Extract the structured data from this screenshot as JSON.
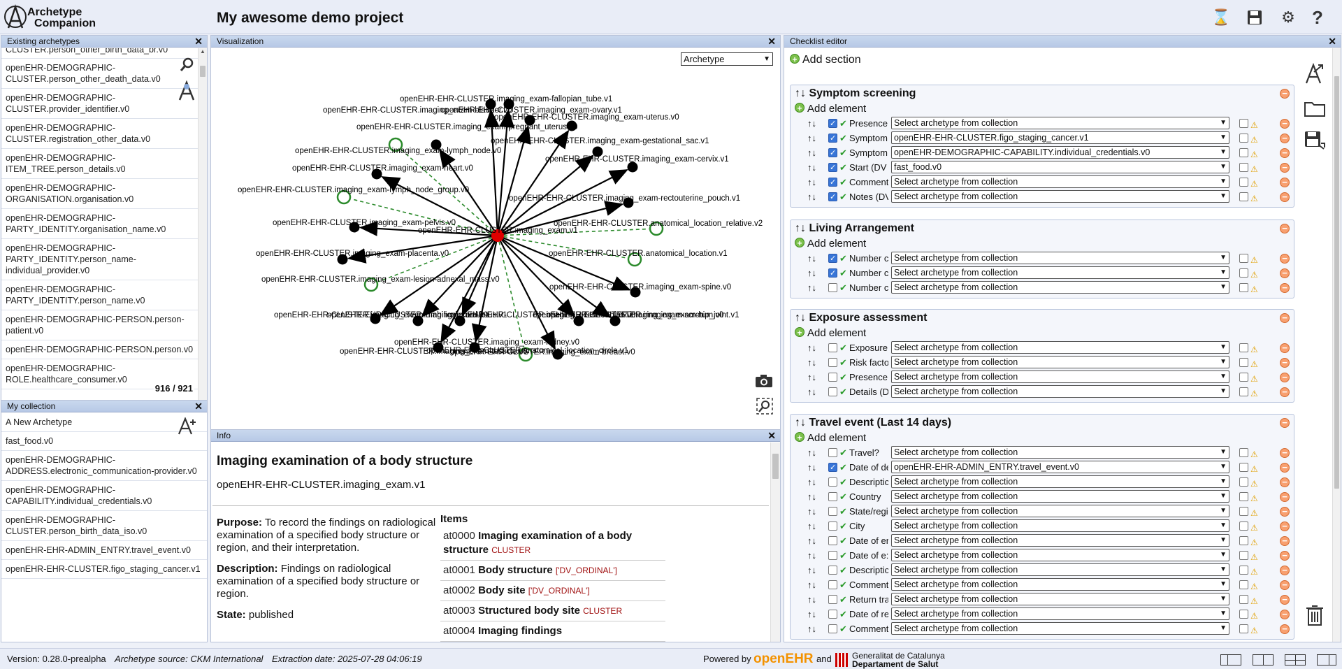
{
  "app": {
    "logo_line1": "Archetype",
    "logo_line2": "Companion",
    "project_title": "My awesome demo project"
  },
  "top_icons": [
    "hourglass-icon",
    "save-icon",
    "gear-icon",
    "help-icon"
  ],
  "existing_archetypes": {
    "title": "Existing archetypes",
    "items": [
      "CLUSTER.person_other_birth_data_br.v0",
      "openEHR-DEMOGRAPHIC-CLUSTER.person_other_death_data.v0",
      "openEHR-DEMOGRAPHIC-CLUSTER.provider_identifier.v0",
      "openEHR-DEMOGRAPHIC-CLUSTER.registration_other_data.v0",
      "openEHR-DEMOGRAPHIC-ITEM_TREE.person_details.v0",
      "openEHR-DEMOGRAPHIC-ORGANISATION.organisation.v0",
      "openEHR-DEMOGRAPHIC-PARTY_IDENTITY.organisation_name.v0",
      "openEHR-DEMOGRAPHIC-PARTY_IDENTITY.person_name-individual_provider.v0",
      "openEHR-DEMOGRAPHIC-PARTY_IDENTITY.person_name.v0",
      "openEHR-DEMOGRAPHIC-PERSON.person-patient.v0",
      "openEHR-DEMOGRAPHIC-PERSON.person.v0",
      "openEHR-DEMOGRAPHIC-ROLE.healthcare_consumer.v0"
    ],
    "count": "916 / 921"
  },
  "my_collection": {
    "title": "My collection",
    "items": [
      "A New Archetype",
      "fast_food.v0",
      "openEHR-DEMOGRAPHIC-ADDRESS.electronic_communication-provider.v0",
      "openEHR-DEMOGRAPHIC-CAPABILITY.individual_credentials.v0",
      "openEHR-DEMOGRAPHIC-CLUSTER.person_birth_data_iso.v0",
      "openEHR-EHR-ADMIN_ENTRY.travel_event.v0",
      "openEHR-EHR-CLUSTER.figo_staging_cancer.v1"
    ]
  },
  "visualization": {
    "title": "Visualization",
    "select_value": "Archetype",
    "center_label": "openEHR-EHR-CLUSTER.imaging_exam.v1",
    "nodes": [
      {
        "label": "openEHR-EHR-CLUSTER.imaging_exam-fallopian_tube.v1",
        "kind": "solid"
      },
      {
        "label": "openEHR-EHR-CLUSTER.imaging_exam-bladder.v0",
        "kind": "solid"
      },
      {
        "label": "openEHR-EHR-CLUSTER.imaging_exam-ovary.v1",
        "kind": "solid"
      },
      {
        "label": "openEHR-EHR-CLUSTER.imaging_exam-uterus.v0",
        "kind": "solid"
      },
      {
        "label": "openEHR-EHR-CLUSTER.imaging_exam-pregnant_uterus.v0",
        "kind": "solid"
      },
      {
        "label": "openEHR-EHR-CLUSTER.imaging_exam-lymph_node.v0",
        "kind": "hollow"
      },
      {
        "label": "openEHR-EHR-CLUSTER.imaging_exam-gestational_sac.v1",
        "kind": "solid"
      },
      {
        "label": "openEHR-EHR-CLUSTER.imaging_exam-heart.v0",
        "kind": "solid"
      },
      {
        "label": "openEHR-EHR-CLUSTER.imaging_exam-cervix.v1",
        "kind": "solid"
      },
      {
        "label": "openEHR-EHR-CLUSTER.imaging_exam-lymph_node_group.v0",
        "kind": "hollow"
      },
      {
        "label": "openEHR-EHR-CLUSTER.imaging_exam-rectouterine_pouch.v1",
        "kind": "solid"
      },
      {
        "label": "openEHR-EHR-CLUSTER.imaging_exam-pelvis.v0",
        "kind": "solid"
      },
      {
        "label": "openEHR-EHR-CLUSTER.anatomical_location_relative.v2",
        "kind": "hollow"
      },
      {
        "label": "openEHR-EHR-CLUSTER.imaging_exam-placenta.v0",
        "kind": "solid"
      },
      {
        "label": "openEHR-EHR-CLUSTER.anatomical_location.v1",
        "kind": "hollow"
      },
      {
        "label": "openEHR-EHR-CLUSTER.imaging_exam-lesion-adnexal_mass.v0",
        "kind": "hollow"
      },
      {
        "label": "openEHR-EHR-CLUSTER.imaging_exam-spine.v0",
        "kind": "solid"
      },
      {
        "label": "openEHR-EHR-CLUSTER.imaging_exam-umbilical_cord.v0",
        "kind": "solid"
      },
      {
        "label": "openEHR-EHR-CLUSTER.imaging_exam-fetus.v1",
        "kind": "solid"
      },
      {
        "label": "openEHR-EHR-CLUSTER.imaging_exam-vagina.v0",
        "kind": "solid"
      },
      {
        "label": "openEHR-EHR-CLUSTER.imaging_exam-scrotum.v0",
        "kind": "solid"
      },
      {
        "label": "openEHR-EHR-CLUSTER.imaging_exam-hip_joint.v1",
        "kind": "solid"
      },
      {
        "label": "openEHR-EHR-CLUSTER.imaging_exam-kidney.v0",
        "kind": "solid"
      },
      {
        "label": "openEHR-EHR-CLUSTER.imaging_exam-testicle.v0",
        "kind": "solid"
      },
      {
        "label": "openEHR-EHR-CLUSTER.anatomical_location_circle.v1",
        "kind": "hollow"
      },
      {
        "label": "openEHR-EHR-CLUSTER.imaging_exam-breast.v0",
        "kind": "solid"
      }
    ]
  },
  "info": {
    "title": "Info",
    "heading": "Imaging examination of a body structure",
    "archetype_id": "openEHR-EHR-CLUSTER.imaging_exam.v1",
    "purpose_label": "Purpose:",
    "purpose": "To record the findings on radiological examination of a specified body structure or region, and their interpretation.",
    "description_label": "Description:",
    "description": "Findings on radiological examination of a specified body structure or region.",
    "state_label": "State:",
    "state": "published",
    "items_heading": "Items",
    "items": [
      {
        "code": "at0000",
        "name": "Imaging examination of a body structure",
        "type": "CLUSTER"
      },
      {
        "code": "at0001",
        "name": "Body structure",
        "type": "['DV_ORDINAL']"
      },
      {
        "code": "at0002",
        "name": "Body site",
        "type": "['DV_ORDINAL']"
      },
      {
        "code": "at0003",
        "name": "Structured body site",
        "type": "CLUSTER"
      },
      {
        "code": "at0004",
        "name": "Imaging findings",
        "type": ""
      }
    ]
  },
  "checklist": {
    "title": "Checklist editor",
    "add_section": "Add section",
    "add_element": "Add element",
    "placeholder": "Select archetype from collection",
    "sections": [
      {
        "name": "Symptom screening",
        "rows": [
          {
            "name": "Presence",
            "checked": true,
            "value": "Select archetype from collection"
          },
          {
            "name": "Symptom",
            "checked": true,
            "value": "openEHR-EHR-CLUSTER.figo_staging_cancer.v1"
          },
          {
            "name": "Symptom",
            "checked": true,
            "value": "openEHR-DEMOGRAPHIC-CAPABILITY.individual_credentials.v0"
          },
          {
            "name": "Start (DV",
            "checked": true,
            "value": "fast_food.v0"
          },
          {
            "name": "Comment",
            "checked": true,
            "value": "Select archetype from collection"
          },
          {
            "name": "Notes (DV",
            "checked": true,
            "value": "Select archetype from collection"
          }
        ]
      },
      {
        "name": "Living Arrangement",
        "rows": [
          {
            "name": "Number c",
            "checked": true,
            "value": "Select archetype from collection"
          },
          {
            "name": "Number c",
            "checked": true,
            "value": "Select archetype from collection"
          },
          {
            "name": "Number c",
            "checked": false,
            "value": "Select archetype from collection"
          }
        ]
      },
      {
        "name": "Exposure assessment",
        "rows": [
          {
            "name": "Exposure",
            "checked": false,
            "value": "Select archetype from collection"
          },
          {
            "name": "Risk facto",
            "checked": false,
            "value": "Select archetype from collection"
          },
          {
            "name": "Presence",
            "checked": false,
            "value": "Select archetype from collection"
          },
          {
            "name": "Details (D",
            "checked": false,
            "value": "Select archetype from collection"
          }
        ]
      },
      {
        "name": "Travel event (Last 14 days)",
        "rows": [
          {
            "name": "Travel?",
            "checked": false,
            "value": "Select archetype from collection"
          },
          {
            "name": "Date of de",
            "checked": true,
            "value": "openEHR-EHR-ADMIN_ENTRY.travel_event.v0"
          },
          {
            "name": "Descriptic",
            "checked": false,
            "value": "Select archetype from collection"
          },
          {
            "name": "Country",
            "checked": false,
            "value": "Select archetype from collection"
          },
          {
            "name": "State/regi",
            "checked": false,
            "value": "Select archetype from collection"
          },
          {
            "name": "City",
            "checked": false,
            "value": "Select archetype from collection"
          },
          {
            "name": "Date of er",
            "checked": false,
            "value": "Select archetype from collection"
          },
          {
            "name": "Date of e:",
            "checked": false,
            "value": "Select archetype from collection"
          },
          {
            "name": "Descriptic",
            "checked": false,
            "value": "Select archetype from collection"
          },
          {
            "name": "Comment",
            "checked": false,
            "value": "Select archetype from collection"
          },
          {
            "name": "Return tra",
            "checked": false,
            "value": "Select archetype from collection"
          },
          {
            "name": "Date of re",
            "checked": false,
            "value": "Select archetype from collection"
          },
          {
            "name": "Comment",
            "checked": false,
            "value": "Select archetype from collection"
          }
        ]
      }
    ]
  },
  "footer": {
    "version": "Version: 0.28.0-prealpha",
    "source": "Archetype source: CKM International",
    "extraction": "Extraction date:  2025-07-28 04:06:19",
    "powered_by": "Powered by",
    "brand_open": "open",
    "brand_ehr": "EHR",
    "and": "and",
    "gencat_line1": "Generalitat de Catalunya",
    "gencat_line2": "Departament de Salut"
  },
  "colors": {
    "accent_green": "#2b8a2b",
    "center_node": "#e00000",
    "openehr_orange": "#f39200",
    "header_bg": "#c9d8ee"
  }
}
